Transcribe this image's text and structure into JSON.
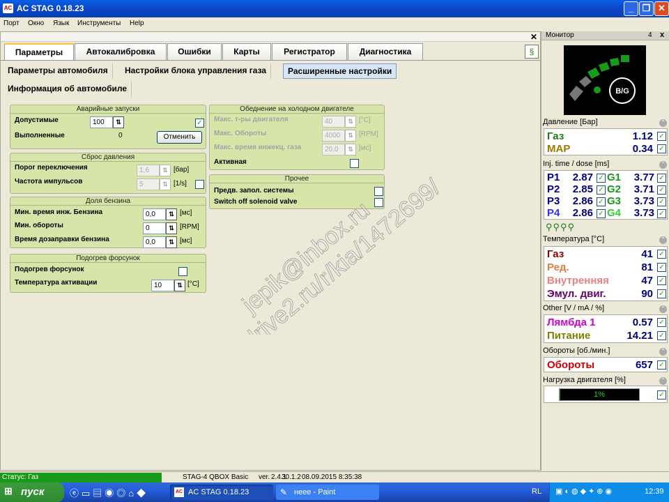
{
  "app": {
    "title": "AC STAG 0.18.23",
    "icon": "stag-app-icon"
  },
  "menu": [
    "Порт",
    "Окно",
    "Язык",
    "Инструменты",
    "Help"
  ],
  "tabs": [
    "Параметры",
    "Автокалибровка",
    "Ошибки",
    "Карты",
    "Регистратор",
    "Диагностика"
  ],
  "subtabs": [
    "Параметры автомобиля",
    "Настройки блока управления газа",
    "Расширенные настройки"
  ],
  "subtab2": "Информация об автомобиле",
  "emergency": {
    "title": "Аварийные запуски",
    "allowed_label": "Допустимые",
    "allowed_value": "100",
    "done_label": "Выполненные",
    "done_value": "0",
    "cancel": "Отменить"
  },
  "pressure_reset": {
    "title": "Сброс давления",
    "threshold_label": "Порог переключения",
    "threshold_value": "1,6",
    "threshold_unit": "[бар]",
    "freq_label": "Частота импульсов",
    "freq_value": "5",
    "freq_unit": "[1/s]"
  },
  "petrol": {
    "title": "Доля бензина",
    "min_inj_label": "Мин. время инж. Бензина",
    "min_inj_value": "0,0",
    "min_inj_unit": "[мс]",
    "min_rpm_label": "Мин. обороты",
    "min_rpm_value": "0",
    "min_rpm_unit": "[RPM]",
    "refuel_label": "Время дозаправки бензина",
    "refuel_value": "0,0",
    "refuel_unit": "[мс]"
  },
  "heater": {
    "title": "Подогрев форсунок",
    "heat_label": "Подогрев форсунок",
    "temp_label": "Температура активации",
    "temp_value": "10",
    "temp_unit": "[°C]"
  },
  "lean": {
    "title": "Обеднение на холодном двигателе",
    "max_temp_label": "Макс. т-ры двигателя",
    "max_temp_value": "40",
    "max_temp_unit": "[°C]",
    "max_rpm_label": "Макс. Обороты",
    "max_rpm_value": "4000",
    "max_rpm_unit": "[RPM]",
    "max_inj_label": "Макс. время инжекц. газа",
    "max_inj_value": "20,0",
    "max_inj_unit": "[мс]",
    "active_label": "Активная"
  },
  "other": {
    "title": "Прочее",
    "prefill_label": "Предв. запол. системы",
    "solenoid_label": "Switch off solenoid valve"
  },
  "monitor": {
    "title": "Монитор",
    "pin": "4",
    "close": "x",
    "bg_label": "B/G",
    "pressure_head": "Давление [Бар]",
    "pressure": [
      {
        "label": "Газ",
        "value": "1.12",
        "color": "#1a7a1a"
      },
      {
        "label": "MAP",
        "value": "0.34",
        "color": "#a07800"
      }
    ],
    "inj_head": "Inj. time / dose [ms]",
    "inj": [
      {
        "p": "P1",
        "pv": "2.87",
        "g": "G1",
        "gv": "3.77"
      },
      {
        "p": "P2",
        "pv": "2.85",
        "g": "G2",
        "gv": "3.71"
      },
      {
        "p": "P3",
        "pv": "2.86",
        "g": "G3",
        "gv": "3.73"
      },
      {
        "p": "P4",
        "pv": "2.86",
        "g": "G4",
        "gv": "3.73"
      }
    ],
    "temp_head": "Температура [°C]",
    "temps": [
      {
        "label": "Газ",
        "value": "41",
        "color": "#8b0000"
      },
      {
        "label": "Ред.",
        "value": "81",
        "color": "#e08040"
      },
      {
        "label": "Внутренняя",
        "value": "47",
        "color": "#f08080"
      },
      {
        "label": "Эмул. двиг.",
        "value": "90",
        "color": "#660066"
      }
    ],
    "other_head": "Other [V / mA / %]",
    "others": [
      {
        "label": "Лямбда 1",
        "value": "0.57",
        "color": "#d000d0"
      },
      {
        "label": "Питание",
        "value": "14.21",
        "color": "#808000"
      }
    ],
    "rpm_head": "Обороты [об./мин.]",
    "rpm": {
      "label": "Обороты",
      "value": "657",
      "color": "#cc0000"
    },
    "load_head": "Нагрузка двигателя [%]",
    "load": {
      "value": "1%",
      "fraction": 0.01
    }
  },
  "status": {
    "left": "Статус: Газ",
    "device": "STAG-4 QBOX Basic",
    "ver_label": "ver.",
    "ver": "2.4.1",
    "ver2": "30.1.2",
    "datetime": "08.09.2015 8:35:38"
  },
  "taskbar": {
    "start": "пуск",
    "app1": "AC STAG 0.18.23",
    "app2": "неее - Paint",
    "lang": "RL",
    "clock": "12:39"
  },
  "watermark": [
    "jepik@inbox.ru",
    "https://www.drive2.ru/r/kia/1472699/"
  ]
}
